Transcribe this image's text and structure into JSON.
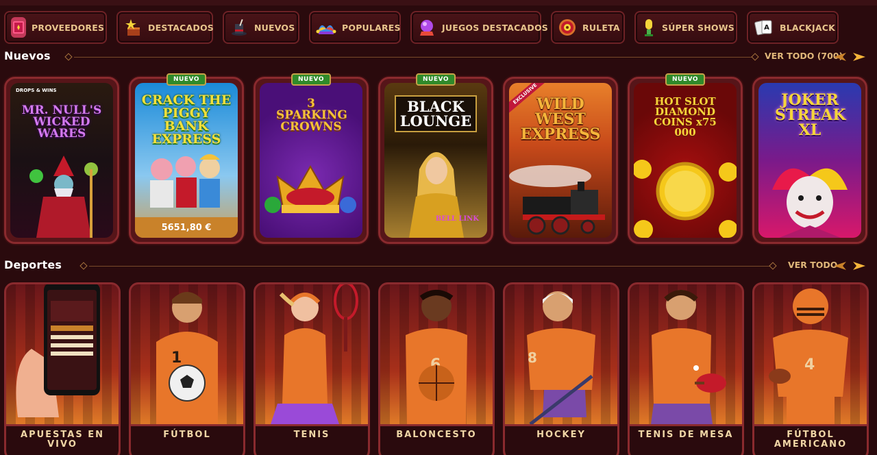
{
  "categories": [
    {
      "label": "PROVEEDORES",
      "icon": "book-icon"
    },
    {
      "label": "DESTACADOS",
      "icon": "star-box-icon"
    },
    {
      "label": "NUEVOS",
      "icon": "magic-hat-icon"
    },
    {
      "label": "POPULARES",
      "icon": "jester-hat-icon"
    },
    {
      "label": "JUEGOS DESTACADOS",
      "icon": "crystal-ball-icon"
    },
    {
      "label": "RULETA",
      "icon": "roulette-icon"
    },
    {
      "label": "SÚPER SHOWS",
      "icon": "microphone-icon"
    },
    {
      "label": "BLACKJACK",
      "icon": "cards-icon"
    }
  ],
  "nuevos": {
    "title": "Nuevos",
    "see_all": "VER TODO (700)",
    "games": [
      {
        "name": "MR. NULL'S WICKED WARES",
        "badge": "",
        "extra": "DROPS & WINS",
        "bg1": "#3a1a14",
        "bg2": "#121018",
        "color": "#c46be8"
      },
      {
        "name": "CRACK THE PIGGY BANK EXPRESS",
        "badge": "NUEVO",
        "jackpot": "5651,80 €",
        "bg1": "#0f6fb8",
        "bg2": "#7fbce8",
        "color": "#f5d53a"
      },
      {
        "name": "3 SPARKING CROWNS",
        "badge": "NUEVO",
        "bg1": "#5a1b8a",
        "bg2": "#3a0f66",
        "color": "#f3c23a"
      },
      {
        "name": "BLACK LOUNGE",
        "badge": "NUEVO",
        "extra": "BELL LINK",
        "bg1": "#3a2a10",
        "bg2": "#8a6a20",
        "color": "#ffffff"
      },
      {
        "name": "WILD WEST EXPRESS",
        "badge": "",
        "extra": "EXCLUSIVE",
        "bg1": "#d86a22",
        "bg2": "#3a140a",
        "color": "#f5b53a"
      },
      {
        "name": "HOT SLOT DIAMOND COINS x75 000",
        "badge": "NUEVO",
        "bg1": "#8a0f0f",
        "bg2": "#5a0a0a",
        "color": "#f5d53a"
      },
      {
        "name": "JOKER STREAK XL",
        "badge": "",
        "bg1": "#2a3aa8",
        "bg2": "#b0185a",
        "color": "#f5d53a"
      }
    ]
  },
  "deportes": {
    "title": "Deportes",
    "see_all": "VER TODO",
    "sports": [
      {
        "label": "APUESTAS EN VIVO",
        "figure": "phone"
      },
      {
        "label": "FÚTBOL",
        "figure": "soccer"
      },
      {
        "label": "TENIS",
        "figure": "tennis"
      },
      {
        "label": "BALONCESTO",
        "figure": "basketball"
      },
      {
        "label": "HOCKEY",
        "figure": "hockey"
      },
      {
        "label": "TENIS DE MESA",
        "figure": "pingpong"
      },
      {
        "label": "FÚTBOL AMERICANO",
        "figure": "football"
      }
    ]
  }
}
